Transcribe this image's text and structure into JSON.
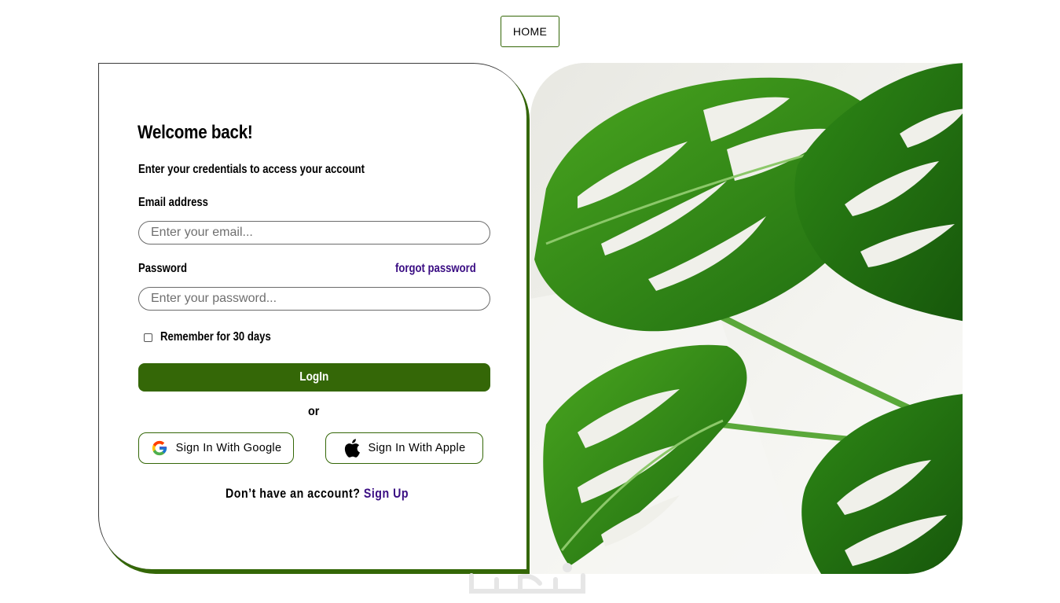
{
  "nav": {
    "home_label": "HOME"
  },
  "login": {
    "title": "Welcome back!",
    "subtitle": "Enter your credentials to access your account",
    "email_label": "Email address",
    "email_placeholder": "Enter your email...",
    "email_value": "",
    "password_label": "Password",
    "forgot_label": "forgot password",
    "password_placeholder": "Enter your password...",
    "password_value": "",
    "remember_label": "Remember for 30 days",
    "remember_checked": false,
    "login_label": "LogIn",
    "or_label": "or",
    "google_label": "Sign In With Google",
    "apple_label": "Sign In With Apple",
    "signup_prompt": "Don’t have an account?",
    "signup_link": "Sign Up"
  },
  "colors": {
    "accent": "#346707",
    "link": "#3a0d83",
    "leaf_dark": "#1f6b12",
    "leaf_light": "#3f9b1f"
  },
  "images": {
    "hero": "monstera-leaves-photo"
  },
  "watermark": {
    "text": "خمسات"
  },
  "icons": {
    "google": "google-g-icon",
    "apple": "apple-logo-icon"
  }
}
